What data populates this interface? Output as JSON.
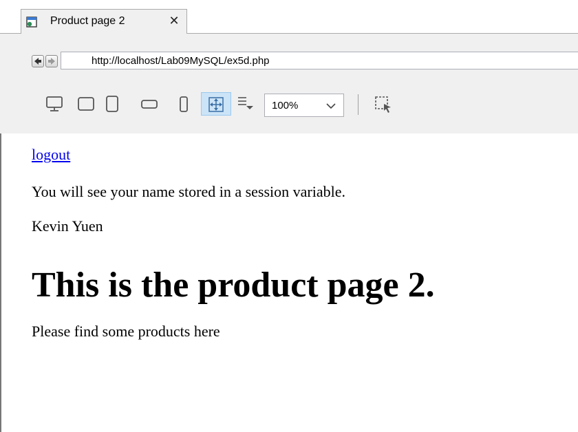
{
  "tab": {
    "title": "Product page 2",
    "close_glyph": "✕",
    "icon": "page-icon"
  },
  "address_bar": {
    "url": "http://localhost/Lab09MySQL/ex5d.php"
  },
  "toolbar": {
    "zoom": "100%",
    "icons": [
      "desktop-icon",
      "laptop-icon",
      "tablet-icon",
      "tablet-landscape-icon",
      "phone-icon",
      "fit-to-window-icon",
      "wrap-icon",
      "inspect-icon"
    ]
  },
  "page": {
    "logout_link": "logout",
    "session_message": "You will see your name stored in a session variable.",
    "user_name": "Kevin Yuen",
    "heading": "This is the product page 2.",
    "body_text": "Please find some products here"
  },
  "colors": {
    "link": "#0000ee",
    "chrome_bg": "#f0f0f0",
    "selected_tool": "#cce4f7"
  }
}
